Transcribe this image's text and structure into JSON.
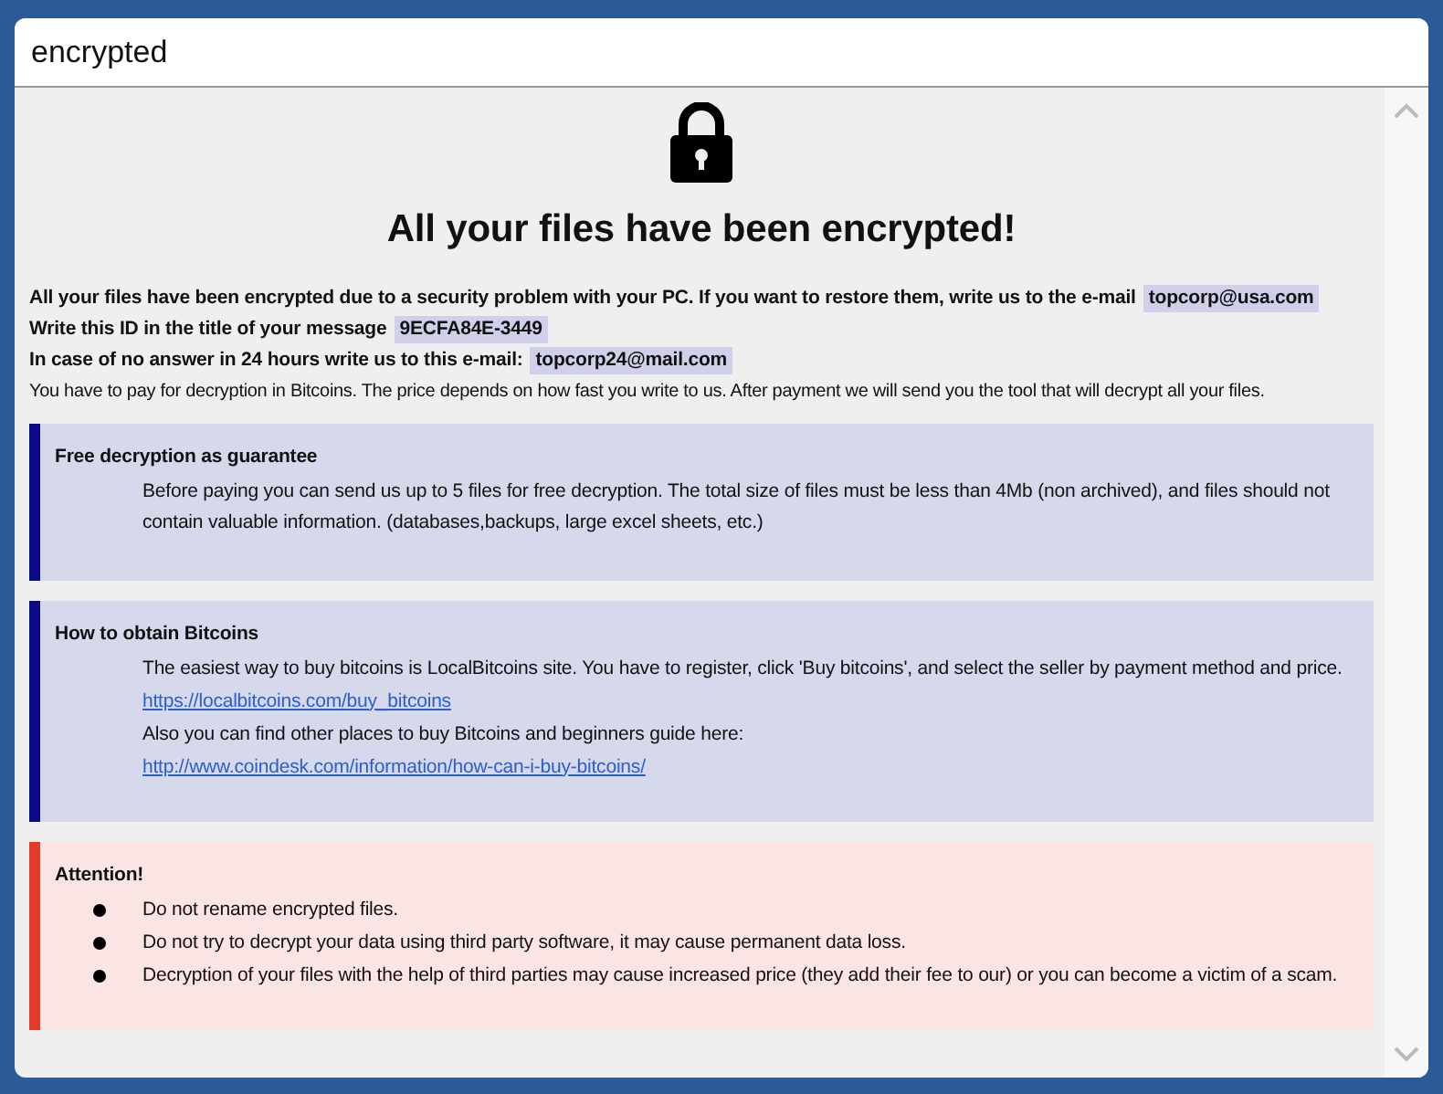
{
  "window": {
    "title": "encrypted"
  },
  "heading": "All your files have been encrypted!",
  "intro": [
    {
      "bold": true,
      "parts": [
        {
          "text": "All your files have been encrypted due to a security problem with your PC. If you want to restore them, write us to the e-mail",
          "highlighted": false
        },
        {
          "text": "topcorp@usa.com",
          "highlighted": true
        }
      ]
    },
    {
      "bold": true,
      "parts": [
        {
          "text": "Write this ID in the title of your message",
          "highlighted": false
        },
        {
          "text": "9ECFA84E-3449",
          "highlighted": true
        }
      ]
    },
    {
      "bold": true,
      "parts": [
        {
          "text": "In case of no answer in 24 hours write us to this e-mail:",
          "highlighted": false
        },
        {
          "text": "topcorp24@mail.com",
          "highlighted": true
        }
      ]
    },
    {
      "bold": false,
      "parts": [
        {
          "text": "You have to pay for decryption in Bitcoins. The price depends on how fast you write to us. After payment we will send you the tool that will decrypt all your files.",
          "highlighted": false
        }
      ]
    }
  ],
  "sections": [
    {
      "kind": "info",
      "title": "Free decryption as guarantee",
      "lines": [
        {
          "kind": "text",
          "text": "Before paying you can send us up to 5 files for free decryption. The total size of files must be less than 4Mb (non archived), and files should not contain valuable information. (databases,backups, large excel sheets, etc.)"
        }
      ]
    },
    {
      "kind": "info",
      "title": "How to obtain Bitcoins",
      "lines": [
        {
          "kind": "text",
          "text": "The easiest way to buy bitcoins is LocalBitcoins site. You have to register, click 'Buy bitcoins', and select the seller by payment method and price."
        },
        {
          "kind": "link",
          "text": "https://localbitcoins.com/buy_bitcoins"
        },
        {
          "kind": "text",
          "text": "Also you can find other places to buy Bitcoins and beginners guide here:"
        },
        {
          "kind": "link",
          "text": "http://www.coindesk.com/information/how-can-i-buy-bitcoins/"
        }
      ]
    },
    {
      "kind": "warning",
      "title": "Attention!",
      "lines": [
        {
          "kind": "bullet",
          "text": "Do not rename encrypted files."
        },
        {
          "kind": "bullet",
          "text": "Do not try to decrypt your data using third party software, it may cause permanent data loss."
        },
        {
          "kind": "bullet",
          "text": "Decryption of your files with the help of third parties may cause increased price (they add their fee to our) or you can become a victim of a scam."
        }
      ]
    }
  ]
}
